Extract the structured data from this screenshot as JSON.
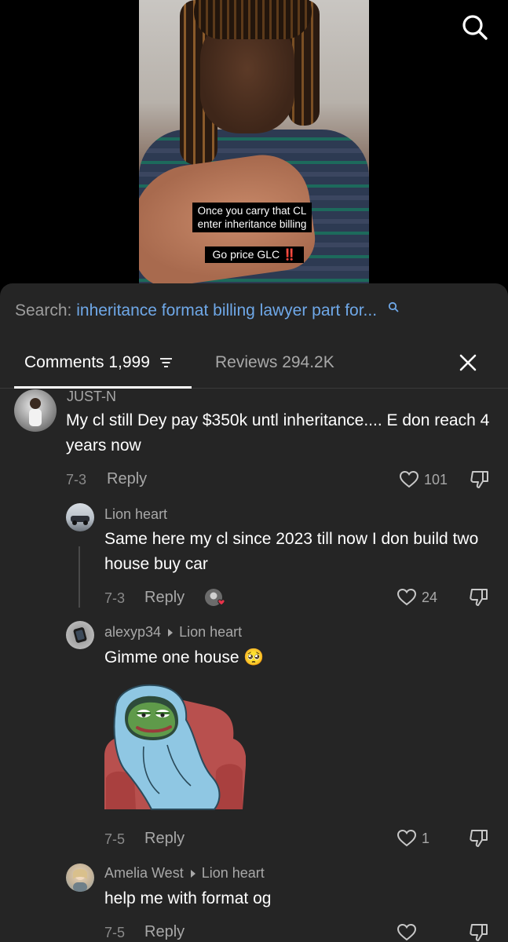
{
  "video": {
    "caption_line1": "Once you carry that CL",
    "caption_line2": "enter inheritance billing",
    "caption_price": "Go price GLC",
    "caption_bang": "‼️",
    "search_icon": "search-icon"
  },
  "search": {
    "prefix": "Search:",
    "query": "inheritance format billing lawyer part for...",
    "icon": "search-icon"
  },
  "tabs": {
    "comments_label": "Comments 1,999",
    "reviews_label": "Reviews 294.2K",
    "filter_icon": "filter-icon",
    "close_icon": "close-icon"
  },
  "comments": [
    {
      "username": "JUST-N",
      "text": "My cl still Dey pay $350k untl inheritance.... E don reach 4 years now",
      "date": "7-3",
      "reply_label": "Reply",
      "likes": "101"
    },
    {
      "username": "Lion heart",
      "text": "Same here my cl since 2023 till now I don build two house buy car",
      "date": "7-3",
      "reply_label": "Reply",
      "likes": "24"
    },
    {
      "username": "alexyp34",
      "reply_to": "Lion heart",
      "text": "Gimme one house 🥺",
      "date": "7-5",
      "reply_label": "Reply",
      "likes": "1"
    },
    {
      "username": "Amelia West",
      "reply_to": "Lion heart",
      "text": "help me with format og",
      "date": "7-5",
      "reply_label": "Reply",
      "likes": ""
    }
  ],
  "colors": {
    "sheet_bg": "#252525",
    "link_blue": "#6fa8e8",
    "muted": "#a8a8a8",
    "like_heart_red": "#e8334a"
  }
}
